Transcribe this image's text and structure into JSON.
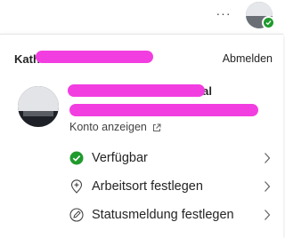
{
  "header": {
    "more_label": "···",
    "presence_status": "available",
    "presence_color": "#1f9a2c"
  },
  "account": {
    "org_name": "Kath",
    "signout_label": "Abmelden",
    "user_name": "nal",
    "user_email": "",
    "view_account_label": "Konto anzeigen"
  },
  "menu": {
    "items": [
      {
        "label": "Verfügbar",
        "icon": "available-check-icon"
      },
      {
        "label": "Arbeitsort festlegen",
        "icon": "location-plus-icon"
      },
      {
        "label": "Statusmeldung festlegen",
        "icon": "edit-pen-icon"
      }
    ]
  },
  "colors": {
    "accent": "#1f9a2c",
    "redaction": "#f23ee0",
    "text": "#242424"
  }
}
